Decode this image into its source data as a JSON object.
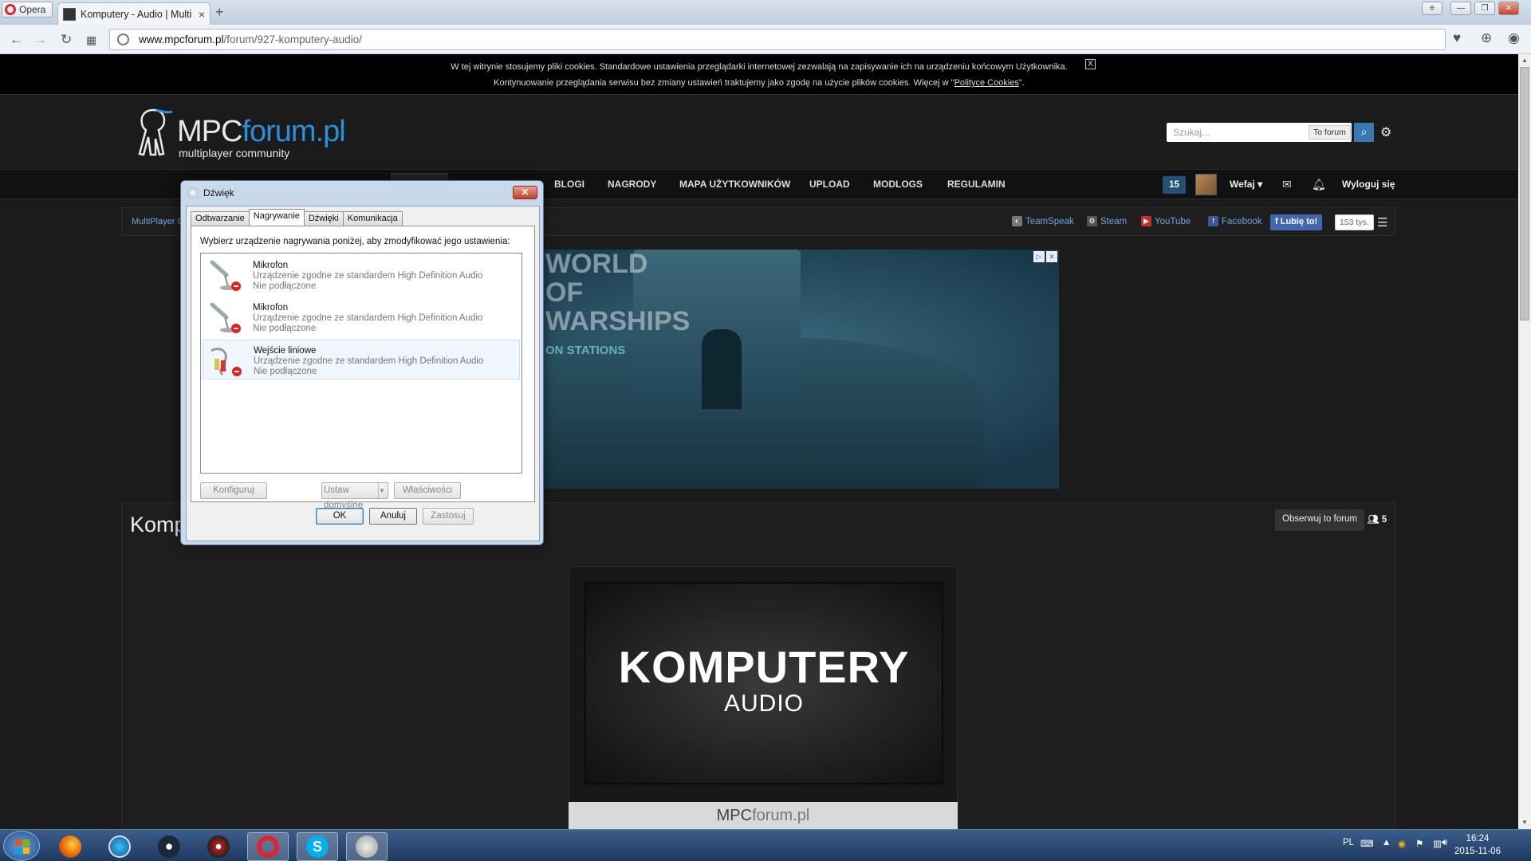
{
  "browser": {
    "menu_label": "Opera",
    "tab_title": "Komputery - Audio | Multi",
    "tab_close": "×",
    "new_tab": "+",
    "url_host": "www.mpcforum.pl",
    "url_path": "/forum/927-komputery-audio/"
  },
  "cookie": {
    "line1": "W tej witrynie stosujemy pliki cookies. Standardowe ustawienia przeglądarki internetowej zezwalają na zapisywanie ich na urządzeniu końcowym Użytkownika.",
    "line2_prefix": "Kontynuowanie przeglądania serwisu bez zmiany ustawień traktujemy jako zgodę na użycie plików cookies. Więcej w \"",
    "link": "Polityce Cookies",
    "line2_suffix": "\".",
    "close": "X"
  },
  "site": {
    "logo_a": "MPC",
    "logo_b": "forum.pl",
    "logo_sub": "multiplayer community",
    "search_placeholder": "Szukaj...",
    "search_scope": "To forum"
  },
  "nav": {
    "items": [
      "BLOGI",
      "NAGRODY",
      "MAPA UŻYTKOWNIKÓW",
      "UPLOAD",
      "MODLOGS",
      "REGULAMIN"
    ],
    "notifications": "15",
    "user": "Wefaj ▾",
    "logout": "Wyloguj się"
  },
  "subbar": {
    "breadcrumb": "MultiPlayer C",
    "social": [
      "TeamSpeak",
      "Steam",
      "YouTube",
      "Facebook"
    ],
    "like": "Lubię to!",
    "like_count": "153 tys."
  },
  "ad": {
    "title": "WORLD OF WARSHIPS",
    "subtitle": "ON STATIONS"
  },
  "content": {
    "title": "Komp",
    "follow": "Obserwuj to forum",
    "followers": "5",
    "banner_title": "KOMPUTERY",
    "banner_sub": "AUDIO",
    "footer_logo_a": "MPC",
    "footer_logo_b": "forum.pl"
  },
  "dialog": {
    "title": "Dźwięk",
    "close": "✕",
    "tabs": [
      "Odtwarzanie",
      "Nagrywanie",
      "Dźwięki",
      "Komunikacja"
    ],
    "active_tab": 1,
    "instruction": "Wybierz urządzenie nagrywania poniżej, aby zmodyfikować jego ustawienia:",
    "devices": [
      {
        "name": "Mikrofon",
        "desc": "Urządzenie zgodne ze standardem High Definition Audio",
        "status": "Nie podłączone"
      },
      {
        "name": "Mikrofon",
        "desc": "Urządzenie zgodne ze standardem High Definition Audio",
        "status": "Nie podłączone"
      },
      {
        "name": "Wejście liniowe",
        "desc": "Urządzenie zgodne ze standardem High Definition Audio",
        "status": "Nie podłączone"
      }
    ],
    "buttons": {
      "configure": "Konfiguruj",
      "set_default": "Ustaw domyślne",
      "properties": "Właściwości",
      "ok": "OK",
      "cancel": "Anuluj",
      "apply": "Zastosuj"
    }
  },
  "taskbar": {
    "lang": "PL",
    "time": "16:24",
    "date": "2015-11-06"
  }
}
